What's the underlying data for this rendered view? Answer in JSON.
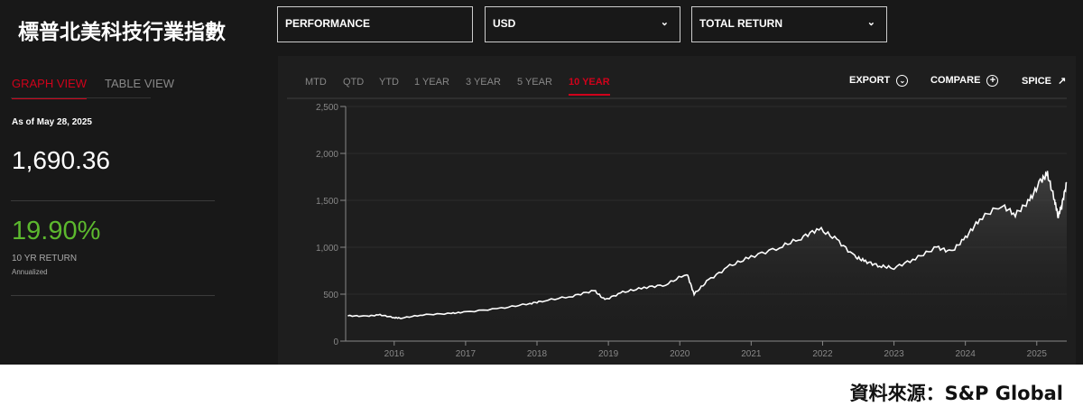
{
  "header": {
    "title": "標普北美科技行業指數",
    "dropdowns": [
      {
        "value": "PERFORMANCE"
      },
      {
        "value": "USD"
      },
      {
        "value": "TOTAL RETURN"
      }
    ]
  },
  "left": {
    "tabs": [
      "GRAPH VIEW",
      "TABLE VIEW"
    ],
    "as_of": "As of May 28, 2025",
    "value": "1,690.36",
    "return": "19.90%",
    "return_label": "10 YR RETURN",
    "annualized": "Annualized"
  },
  "periods": [
    "MTD",
    "QTD",
    "YTD",
    "1 YEAR",
    "3 YEAR",
    "5 YEAR",
    "10 YEAR"
  ],
  "actions": [
    "EXPORT",
    "COMPARE",
    "SPICE"
  ],
  "colors": {
    "accent": "#d0021b",
    "positive": "#5cb82e"
  },
  "chart_data": {
    "type": "area",
    "ylim": [
      0,
      2500
    ],
    "xlim": [
      2015.32,
      2025.42
    ],
    "yticks": [
      "0",
      "500",
      "1,000",
      "1,500",
      "2,000",
      "2,500"
    ],
    "xticks": [
      "2016",
      "2017",
      "2018",
      "2019",
      "2020",
      "2021",
      "2022",
      "2023",
      "2024",
      "2025"
    ],
    "series": [
      {
        "name": "Total Return",
        "x": [
          2015.35,
          2015.6,
          2015.8,
          2016.0,
          2016.1,
          2016.4,
          2016.8,
          2017.0,
          2017.5,
          2017.9,
          2018.1,
          2018.5,
          2018.8,
          2018.95,
          2019.2,
          2019.5,
          2019.8,
          2020.1,
          2020.2,
          2020.4,
          2020.7,
          2021.0,
          2021.4,
          2021.7,
          2021.95,
          2022.2,
          2022.45,
          2022.6,
          2022.8,
          2023.0,
          2023.3,
          2023.6,
          2023.8,
          2024.0,
          2024.2,
          2024.5,
          2024.7,
          2024.9,
          2025.05,
          2025.15,
          2025.25,
          2025.3,
          2025.35,
          2025.42
        ],
        "y": [
          270,
          265,
          280,
          250,
          245,
          280,
          295,
          310,
          350,
          400,
          430,
          480,
          540,
          440,
          520,
          570,
          600,
          720,
          500,
          650,
          800,
          900,
          1000,
          1100,
          1200,
          1080,
          900,
          850,
          800,
          780,
          880,
          1000,
          950,
          1100,
          1300,
          1450,
          1350,
          1500,
          1700,
          1780,
          1500,
          1330,
          1450,
          1690
        ]
      }
    ]
  },
  "footer": "資料來源：S&P Global"
}
